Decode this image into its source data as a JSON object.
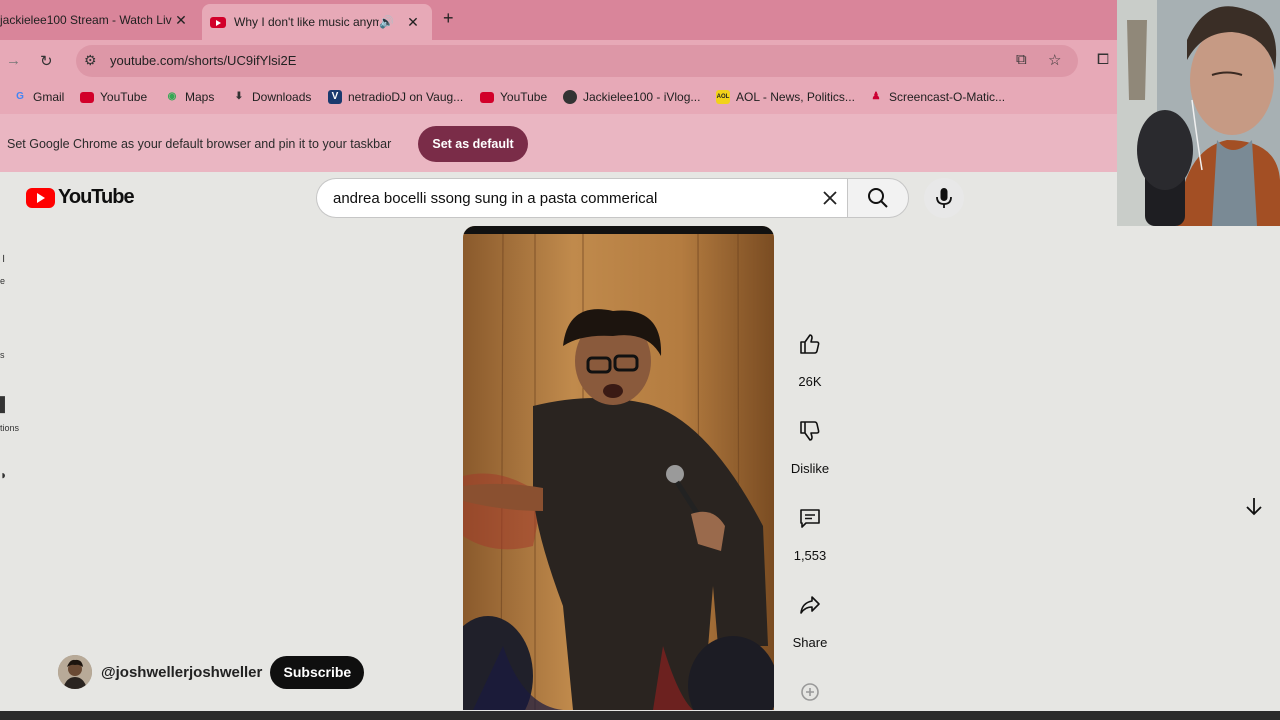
{
  "tabs": [
    {
      "title": "jackielee100 Stream - Watch Liv",
      "close": "✕"
    },
    {
      "title": "Why I don't like music anym",
      "close": "✕"
    }
  ],
  "new_tab": "+",
  "toolbar": {
    "url": "youtube.com/shorts/UC9ifYlsi2E"
  },
  "bookmarks": [
    "Gmail",
    "YouTube",
    "Maps",
    "Downloads",
    "netradioDJ on Vaug...",
    "YouTube",
    "Jackielee100 - iVlog...",
    "AOL - News, Politics...",
    "Screencast-O-Matic..."
  ],
  "infobar": {
    "message": "Set Google Chrome as your default browser and pin it to your taskbar",
    "button": "Set as default"
  },
  "youtube": {
    "logo": "YouTube",
    "search_query": "andrea bocelli ssong sung in a pasta commerical"
  },
  "left_stubs": [
    "e",
    "s",
    "tions"
  ],
  "actions": {
    "likes": "26K",
    "dislike": "Dislike",
    "comments": "1,553",
    "share": "Share"
  },
  "channel": {
    "handle": "@joshwellerjoshweller",
    "subscribe": "Subscribe"
  },
  "colors": {
    "tabstrip": "#d9859a",
    "toolbar": "#e7a9b7",
    "subscribe": "#0f0f0f",
    "set_default": "#7a2c48",
    "brand": "#ff0000"
  }
}
